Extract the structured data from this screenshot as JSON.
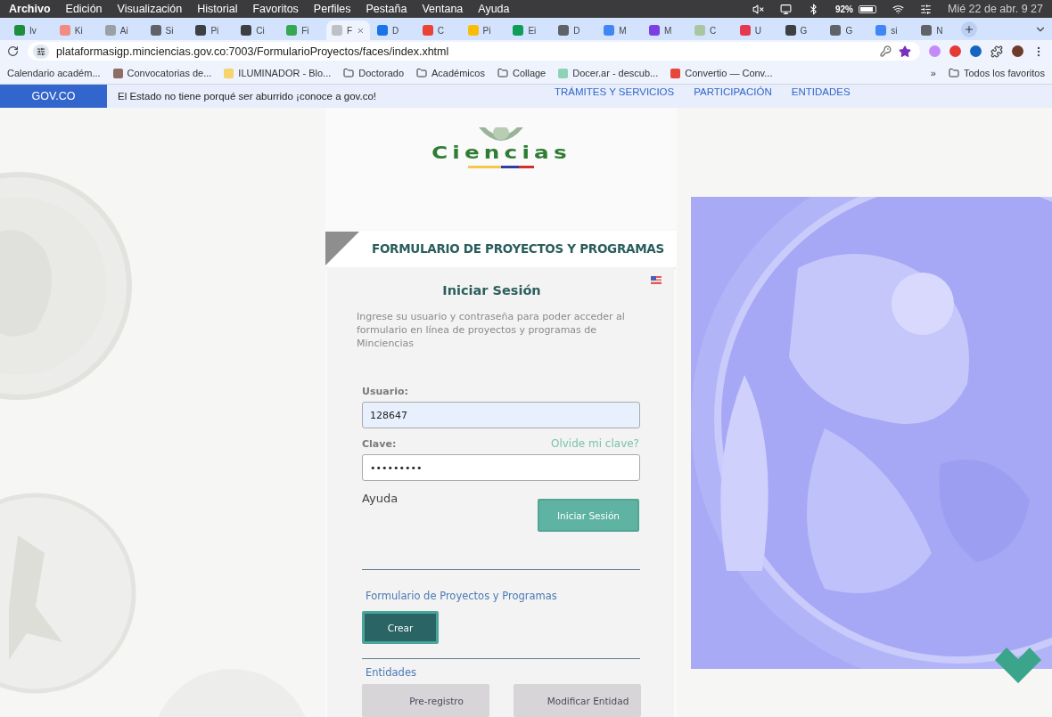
{
  "menu_bar": {
    "items": [
      "Archivo",
      "Edición",
      "Visualización",
      "Historial",
      "Favoritos",
      "Perfiles",
      "Pestaña",
      "Ventana",
      "Ayuda"
    ],
    "battery": "92%",
    "clock": "Mié 22 de abr.  9 27"
  },
  "tabs": [
    {
      "label": "Iv",
      "selected": false,
      "color": "#1e8e3e"
    },
    {
      "label": "Ki",
      "selected": false,
      "color": "#f28b82"
    },
    {
      "label": "Ai",
      "selected": false,
      "color": "#9aa0a6"
    },
    {
      "label": "Si",
      "selected": false,
      "color": "#5f6368"
    },
    {
      "label": "Pi",
      "selected": false,
      "color": "#3c4043"
    },
    {
      "label": "Ci",
      "selected": false,
      "color": "#3c4043"
    },
    {
      "label": "Fi",
      "selected": false,
      "color": "#34a853"
    },
    {
      "label": "F",
      "selected": true,
      "color": "#bdc1c6"
    },
    {
      "label": "D",
      "selected": false,
      "color": "#1a73e8"
    },
    {
      "label": "C",
      "selected": false,
      "color": "#ea4335"
    },
    {
      "label": "Pi",
      "selected": false,
      "color": "#fbbc04"
    },
    {
      "label": "Ei",
      "selected": false,
      "color": "#0f9d58"
    },
    {
      "label": "D",
      "selected": false,
      "color": "#5f6368"
    },
    {
      "label": "M",
      "selected": false,
      "color": "#4285f4"
    },
    {
      "label": "M",
      "selected": false,
      "color": "#7b3fe4"
    },
    {
      "label": "C",
      "selected": false,
      "color": "#a8c7a0"
    },
    {
      "label": "U",
      "selected": false,
      "color": "#e53950"
    },
    {
      "label": "G",
      "selected": false,
      "color": "#3c4043"
    },
    {
      "label": "G",
      "selected": false,
      "color": "#5f6368"
    },
    {
      "label": "si",
      "selected": false,
      "color": "#4285f4"
    },
    {
      "label": "N",
      "selected": false,
      "color": "#5f6368"
    }
  ],
  "address_bar": {
    "url": "plataformasigp.minciencias.gov.co:7003/FormularioProyectos/faces/index.xhtml"
  },
  "bookmarks": [
    {
      "label": "Calendario académ...",
      "kind": "text"
    },
    {
      "label": "Convocatorias de...",
      "kind": "site",
      "color": "#8d6e63"
    },
    {
      "label": "ILUMINADOR - Blo...",
      "kind": "site",
      "color": "#f6d36b"
    },
    {
      "label": "Doctorado",
      "kind": "folder"
    },
    {
      "label": "Académicos",
      "kind": "folder"
    },
    {
      "label": "Collage",
      "kind": "folder"
    },
    {
      "label": "Docer.ar - descub...",
      "kind": "site",
      "color": "#8fd3b6"
    },
    {
      "label": "Convertio — Conv...",
      "kind": "site",
      "color": "#e8453c"
    }
  ],
  "bookmarks_overflow": "»",
  "all_bookmarks": "Todos los favoritos",
  "gov_bar": {
    "logo": "GOV.CO",
    "message": "El Estado no tiene porqué ser aburrido ¡conoce a gov.co!",
    "links": [
      "TRÁMITES Y SERVICIOS",
      "PARTICIPACIÓN",
      "ENTIDADES"
    ]
  },
  "logo": {
    "text": "Ciencias"
  },
  "heading": "FORMULARIO DE PROYECTOS Y PROGRAMAS",
  "login": {
    "title": "Iniciar Sesión",
    "intro": "Ingrese su usuario y contraseña para poder acceder al formulario en línea de proyectos y programas de Minciencias",
    "user_label": "Usuario:",
    "user_value": "128647",
    "password_label": "Clave:",
    "forgot_link": "Olvide mi clave?",
    "password_value": "•••••••••",
    "help": "Ayuda",
    "submit": "Iniciar Sesión"
  },
  "sections": [
    {
      "title": "Formulario de Proyectos y Programas",
      "buttons": [
        "Crear"
      ],
      "kind": "dark"
    },
    {
      "title": "Entidades",
      "buttons": [
        "Pre-registro",
        "Modificar Entidad"
      ],
      "kind": "grey"
    }
  ]
}
